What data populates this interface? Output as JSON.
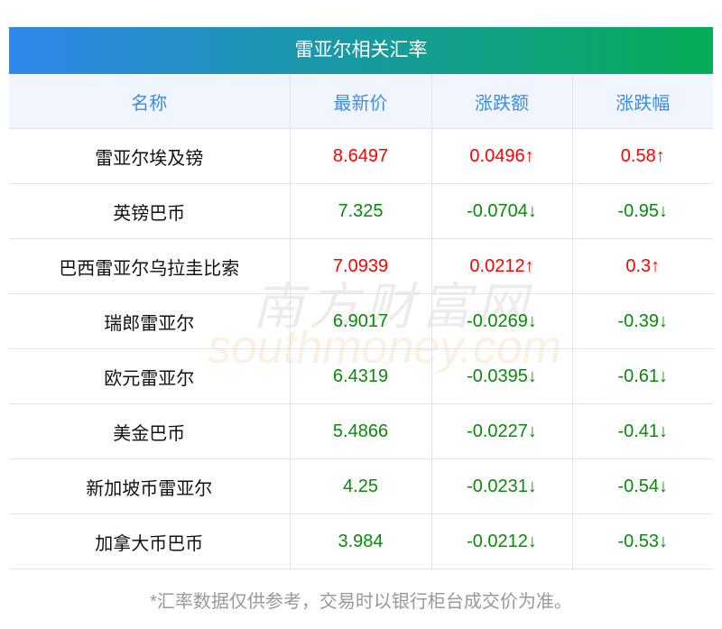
{
  "title": "雷亚尔相关汇率",
  "headers": [
    "名称",
    "最新价",
    "涨跌额",
    "涨跌幅"
  ],
  "rows": [
    {
      "name": "雷亚尔埃及镑",
      "price": "8.6497",
      "change": "0.0496↑",
      "pct": "0.58↑",
      "dir": "up"
    },
    {
      "name": "英镑巴币",
      "price": "7.325",
      "change": "-0.0704↓",
      "pct": "-0.95↓",
      "dir": "down"
    },
    {
      "name": "巴西雷亚尔乌拉圭比索",
      "price": "7.0939",
      "change": "0.0212↑",
      "pct": "0.3↑",
      "dir": "up"
    },
    {
      "name": "瑞郎雷亚尔",
      "price": "6.9017",
      "change": "-0.0269↓",
      "pct": "-0.39↓",
      "dir": "down"
    },
    {
      "name": "欧元雷亚尔",
      "price": "6.4319",
      "change": "-0.0395↓",
      "pct": "-0.61↓",
      "dir": "down"
    },
    {
      "name": "美金巴币",
      "price": "5.4866",
      "change": "-0.0227↓",
      "pct": "-0.41↓",
      "dir": "down"
    },
    {
      "name": "新加坡币雷亚尔",
      "price": "4.25",
      "change": "-0.0231↓",
      "pct": "-0.54↓",
      "dir": "down"
    },
    {
      "name": "加拿大币巴币",
      "price": "3.984",
      "change": "-0.0212↓",
      "pct": "-0.53↓",
      "dir": "down"
    }
  ],
  "footer": "*汇率数据仅供参考，交易时以银行柜台成交价为准。",
  "watermark": {
    "cn": "南方财富网",
    "en": "southmoney.com"
  },
  "colors": {
    "up": "#ff0000",
    "down": "#0a8a0a",
    "header_text": "#3d8de6"
  }
}
